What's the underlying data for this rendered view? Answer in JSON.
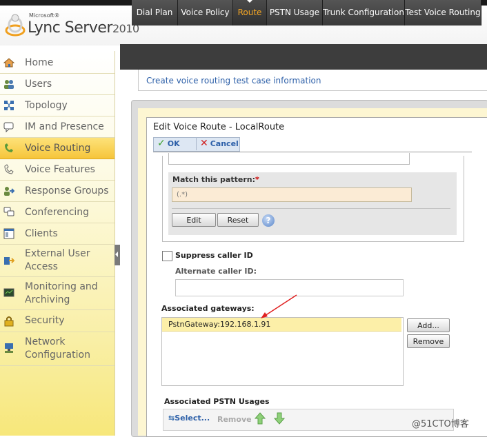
{
  "app": {
    "brand_small": "Microsoft®",
    "product": "Lync Server",
    "year": "2010"
  },
  "sidebar": {
    "items": [
      {
        "label": "Home",
        "icon": "home-icon"
      },
      {
        "label": "Users",
        "icon": "users-icon"
      },
      {
        "label": "Topology",
        "icon": "topology-icon"
      },
      {
        "label": "IM and Presence",
        "icon": "im-icon"
      },
      {
        "label": "Voice Routing",
        "icon": "voice-routing-icon",
        "active": true
      },
      {
        "label": "Voice Features",
        "icon": "phone-icon"
      },
      {
        "label": "Response Groups",
        "icon": "response-groups-icon"
      },
      {
        "label": "Conferencing",
        "icon": "conferencing-icon"
      },
      {
        "label": "Clients",
        "icon": "clients-icon"
      },
      {
        "label": "External User Access",
        "icon": "external-access-icon"
      },
      {
        "label": "Monitoring and Archiving",
        "icon": "monitoring-icon"
      },
      {
        "label": "Security",
        "icon": "lock-icon"
      },
      {
        "label": "Network Configuration",
        "icon": "network-icon"
      }
    ]
  },
  "tabs": [
    {
      "label": "Dial Plan"
    },
    {
      "label": "Voice Policy"
    },
    {
      "label": "Route",
      "active": true
    },
    {
      "label": "PSTN Usage"
    },
    {
      "label": "Trunk Configuration"
    },
    {
      "label": "Test Voice Routing"
    }
  ],
  "breadcrumb": "Create voice routing test case information",
  "dialog": {
    "title": "Edit Voice Route - LocalRoute",
    "ok_label": "OK",
    "cancel_label": "Cancel",
    "match_pattern_label": "Match this pattern:",
    "required_mark": "*",
    "match_pattern_value": "(.*)",
    "edit_label": "Edit",
    "reset_label": "Reset",
    "help_glyph": "?",
    "suppress_caller_id_label": "Suppress caller ID",
    "suppress_caller_id_checked": false,
    "alternate_caller_id_label": "Alternate caller ID:",
    "alternate_caller_id_value": "",
    "gateways_label": "Associated gateways:",
    "gateways": [
      "PstnGateway:192.168.1.91"
    ],
    "add_label": "Add...",
    "remove_label": "Remove",
    "pstn_usages_label": "Associated PSTN Usages",
    "select_label": "Select...",
    "pstn_remove_label": "Remove"
  },
  "watermark": "@51CTO博客",
  "colors": {
    "accent_orange": "#f5a623",
    "link_blue": "#2c5fa8",
    "active_nav": "#f6c53a",
    "annotation_arrow": "#e02020"
  }
}
